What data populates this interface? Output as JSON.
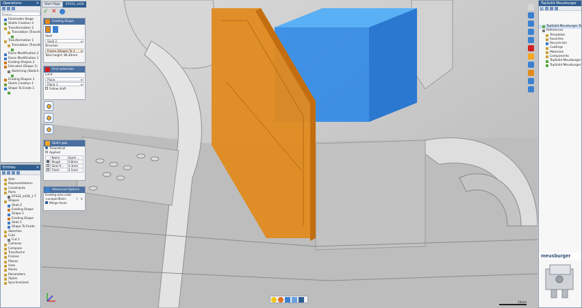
{
  "operations": {
    "title": "Operations",
    "search_placeholder": "Search...",
    "items": [
      {
        "label": "Electrodes Stage",
        "indent": 1,
        "color": "#3b7ac9"
      },
      {
        "label": "Shells Creation 2",
        "indent": 1,
        "color": "#6a9c3a"
      },
      {
        "label": "Transformation 2",
        "indent": 1,
        "color": "#c9a23b"
      },
      {
        "label": "Translation (Transform",
        "indent": 2,
        "color": "#c9a23b"
      },
      {
        "label": "",
        "indent": 3,
        "color": "#58a846"
      },
      {
        "label": "Transformation 1",
        "indent": 1,
        "color": "#c9a23b"
      },
      {
        "label": "Translation (Transform",
        "indent": 2,
        "color": "#c9a23b"
      },
      {
        "label": "",
        "indent": 3,
        "color": "#58a846"
      },
      {
        "label": "Faces Modification 2",
        "indent": 1,
        "color": "#3b7ac9"
      },
      {
        "label": "Faces Modification 1",
        "indent": 1,
        "color": "#3b7ac9"
      },
      {
        "label": "Eroding Shapes 2",
        "indent": 1,
        "color": "#d0761c"
      },
      {
        "label": "Extruded (Shape 1)",
        "indent": 1,
        "color": "#d0761c"
      },
      {
        "label": "Sketching (Sketch 1)",
        "indent": 2,
        "color": "#7a7a7a"
      },
      {
        "label": "",
        "indent": 3,
        "color": "#58a846"
      },
      {
        "label": "Eroding Shapes 1",
        "indent": 1,
        "color": "#d0761c"
      },
      {
        "label": "Shells Creation 1",
        "indent": 1,
        "color": "#6a9c3a"
      },
      {
        "label": "Shape To Erode 1",
        "indent": 1,
        "color": "#3b7ac9"
      },
      {
        "label": "",
        "indent": 2,
        "color": "#58a846"
      }
    ]
  },
  "entities": {
    "title": "Entities",
    "items": [
      {
        "label": "Sets",
        "indent": 1,
        "color": "#c9a23b"
      },
      {
        "label": "Representations",
        "indent": 1,
        "color": "#c9a23b"
      },
      {
        "label": "Constraints",
        "indent": 1,
        "color": "#c9a23b"
      },
      {
        "label": "Parts",
        "indent": 1,
        "color": "#c9a23b"
      },
      {
        "label": "SYS32_sd34_1.T",
        "indent": 2,
        "color": "#6a6a6a"
      },
      {
        "label": "Shapes",
        "indent": 1,
        "color": "#c9a23b"
      },
      {
        "label": "Shell 2",
        "indent": 2,
        "color": "#3b7ac9"
      },
      {
        "label": "Eroding Shape",
        "indent": 2,
        "color": "#d0761c"
      },
      {
        "label": "Shape 1",
        "indent": 2,
        "color": "#3b7ac9"
      },
      {
        "label": "Eroding Shape",
        "indent": 2,
        "color": "#d0761c"
      },
      {
        "label": "Shell 1",
        "indent": 2,
        "color": "#3b7ac9"
      },
      {
        "label": "Shape To Erode",
        "indent": 2,
        "color": "#3b7ac9"
      },
      {
        "label": "Sketches",
        "indent": 1,
        "color": "#c9a23b"
      },
      {
        "label": "Cuts",
        "indent": 1,
        "color": "#c9a23b"
      },
      {
        "label": "Cut 1",
        "indent": 2,
        "color": "#7a7a7a"
      },
      {
        "label": "Cameras",
        "indent": 1,
        "color": "#c9a23b"
      },
      {
        "label": "Compass",
        "indent": 1,
        "color": "#c9a23b"
      },
      {
        "label": "Transforms",
        "indent": 1,
        "color": "#c9a23b"
      },
      {
        "label": "Frames",
        "indent": 1,
        "color": "#c9a23b"
      },
      {
        "label": "Planes",
        "indent": 1,
        "color": "#c9a23b"
      },
      {
        "label": "Axes",
        "indent": 1,
        "color": "#c9a23b"
      },
      {
        "label": "Points",
        "indent": 1,
        "color": "#c9a23b"
      },
      {
        "label": "Parameters",
        "indent": 1,
        "color": "#c9a23b"
      },
      {
        "label": "Styles",
        "indent": 1,
        "color": "#c9a23b"
      },
      {
        "label": "Synchronized",
        "indent": 1,
        "color": "#c9a23b"
      }
    ]
  },
  "tabs": [
    {
      "label": "Start Page"
    },
    {
      "label": "SYS32_sd34"
    }
  ],
  "eroding_shape": {
    "header": "Eroding Shape",
    "shell_label": "Shell",
    "shell_value": "Shell 2",
    "direction_label": "Direction",
    "direction_value": "Frame (Shape) To 1",
    "total_height": "Total height: 86.40mm"
  },
  "first_extension": {
    "header": "First extension",
    "limit_label": "Limit",
    "limit_value": "Plane",
    "plane_value": "Plane 1",
    "follow_draft": "Follow draft"
  },
  "spark_gap": {
    "header": "Spark gap",
    "theoretical": "Theoretical",
    "applied": "Applied",
    "columns": [
      "Name",
      "Spark ..."
    ],
    "rows": [
      {
        "name": "Rough",
        "value": "0.8mm"
      },
      {
        "name": "Semi fi...",
        "value": "0.3mm"
      },
      {
        "name": "Finish",
        "value": "0.1mm"
      }
    ]
  },
  "advanced_options": {
    "header": "Advanced Options",
    "eroding_area_color": "Eroding area color",
    "color_value": "<unspecified>",
    "merge_faces": "Merge faces"
  },
  "library": {
    "title": "TopSolid Meusburger To...",
    "items": [
      {
        "label": "TopSolid Meusburger Tools",
        "indent": 1,
        "color": "#58a846",
        "selected": true
      },
      {
        "label": "References",
        "indent": 1,
        "color": "#7a7a7a"
      },
      {
        "label": "Templates",
        "indent": 2,
        "color": "#c9a23b"
      },
      {
        "label": "Favorites",
        "indent": 2,
        "color": "#c9a23b"
      },
      {
        "label": "Recycle bin",
        "indent": 2,
        "color": "#3b7ac9"
      },
      {
        "label": "Coatings",
        "indent": 2,
        "color": "#c9a23b"
      },
      {
        "label": "Materials",
        "indent": 2,
        "color": "#c9a23b"
      },
      {
        "label": "Components",
        "indent": 2,
        "color": "#c9a23b"
      },
      {
        "label": "TopSolid Meusburger Tools",
        "indent": 2,
        "color": "#58a846"
      },
      {
        "label": "TopSolid Meusburger Tools",
        "indent": 2,
        "color": "#58a846"
      }
    ]
  },
  "brand": {
    "text": "meusburger"
  },
  "scale": {
    "label": "10mm"
  },
  "colors": {
    "title_bar": "#2f5d8f",
    "orange_shape": "#e08a1e",
    "blue_shape": "#2f86e0",
    "viewport_bg": "#c9c9c9"
  }
}
